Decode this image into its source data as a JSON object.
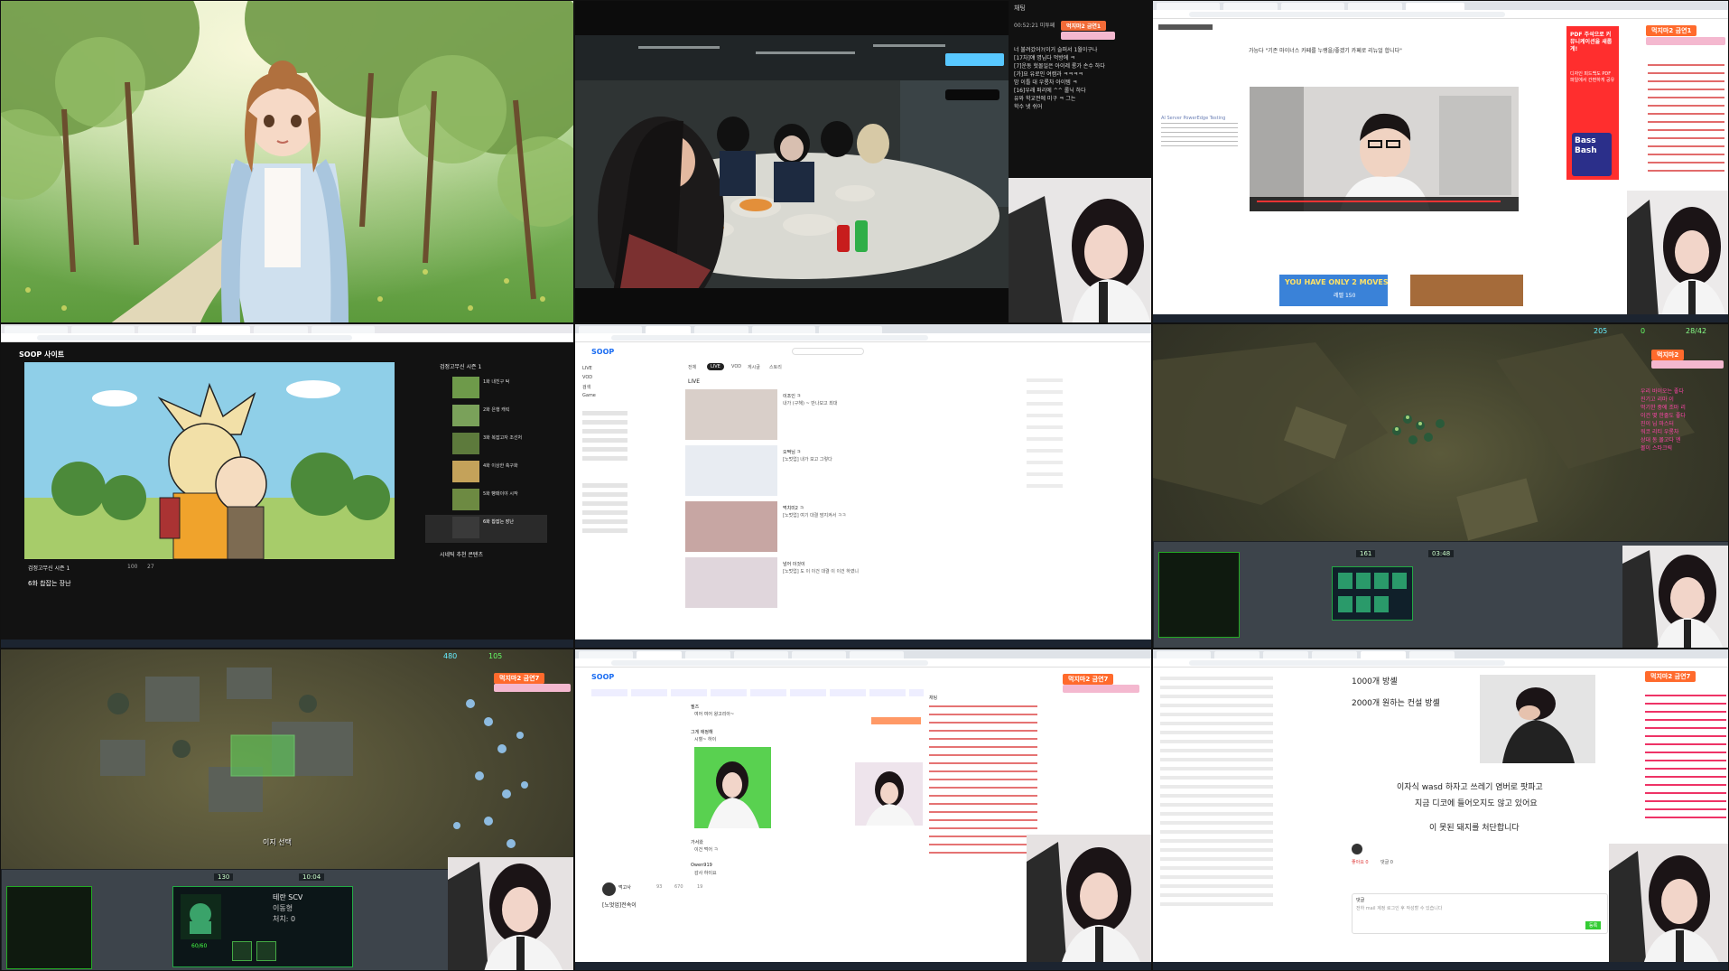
{
  "tile_top_middle": {
    "chat_title": "채팅",
    "badge": "먹지마2 금연1",
    "cam_label": "먹지마2",
    "chat_time": "00:52:21 미투페",
    "lines": [
      "너 불려갔어?(이거 슬퍼서 1월이구나",
      "[17차]얘 명님다 먹방에 ㅋ",
      "[7]운동 헛몰일은 아이레 롱가 손수 하다",
      "[가]요 유로인 여캠과 ㅋㅋㅋㅋ",
      "밤 이틀 대 우롱차 아이템 ㅋ",
      "[16]우래 퍼리에 ^^ 롤닉 하다",
      "유와 학교전에 미구 ㅋ 그는",
      "학수 넷 쉬어"
    ]
  },
  "tile_top_right": {
    "badge": "먹지마2 금연1",
    "article_title": "가능다 \"기존 마이너스 카페를 누랭을/좋겠기 카페로 리뉴얼 합니다\"",
    "side_ad": "PDF 주석으로 커뮤니케이션을 새롭게!",
    "side_ad_sub": "디자인 피드백도 PDF 파일에서 간편하게 공유",
    "side_ad_book": "Bass Bash",
    "banner_left": "YOU HAVE ONLY 2 MOVES",
    "banner_left_sub": "레벨 150",
    "ad_left_title": "AI Server PowerEdge Testing"
  },
  "tile_mid_left": {
    "logo": "SOOP 사이트",
    "side_title": "검정고무신 시즌 1",
    "playlist": [
      {
        "title": "1화 내친구 탁"
      },
      {
        "title": "2화 은행 캐릭"
      },
      {
        "title": "3화 복잡고자 조선처"
      },
      {
        "title": "4화 이상한 축구화"
      },
      {
        "title": "5화 빵패이야 시작"
      },
      {
        "title": "6화 찹잡는 장난"
      }
    ],
    "video_title": "6화 찹잡는 장난",
    "related": "시네틱 추천 콘텐츠",
    "channel": "검정고무신 시즌 1",
    "views": "100",
    "likes": "27"
  },
  "tile_mid_center": {
    "logo": "SOOP",
    "section": "LIVE",
    "filters": [
      "전체",
      "LIVE",
      "VOD",
      "게시글",
      "스토리"
    ],
    "results": [
      {
        "title": "내가 (구해) ~ 반나보고 최대",
        "host": "이조인 ㅋ"
      },
      {
        "title": "[노멋업] 내가 보고 그렇다",
        "host": "오짝님 ㅋ"
      },
      {
        "title": "[노멋업] 여기 대결 맘지켜서 ㅋㅋ",
        "host": "먹치미2 ㅋ"
      },
      {
        "title": "[노멋업] 도 이 이건 대결 이 이건 하였니",
        "host": "넘어 이것이"
      }
    ],
    "side_menu": [
      "LIVE",
      "VOD",
      "검색",
      "Game"
    ]
  },
  "tile_mid_right": {
    "minerals": "205",
    "gas": "0",
    "supply": "28/42",
    "badge": "먹지마2",
    "time": "03:48",
    "count": "161",
    "chat": [
      "우리 바이오는 좋다",
      "진기고 리마 이",
      "먹기한 중에 조마 리",
      "이건 몇 한줄도 좋다",
      "진이 님 마스터",
      "워코 리티 우롱차",
      "상대 동 몰고다 엔",
      "몰이 스타크릭"
    ]
  },
  "tile_bot_left": {
    "badge": "먹지마2 금연7",
    "unit_name": "테란 SCV",
    "unit_status": "이동형",
    "unit_kills": "처치: 0",
    "unit_hp": "60/60",
    "select_text": "이지 선택",
    "time": "10:04",
    "count": "130",
    "minerals": "480",
    "gas": "105"
  },
  "tile_bot_center": {
    "logo": "SOOP",
    "badge": "먹지마2 금연7",
    "chat_title": "채팅",
    "post_name": "먹고사",
    "post_title": "[노멋업]전속이",
    "messages": [
      {
        "user": "필즈",
        "text": "여어 여어 왕고리아~"
      },
      {
        "user": "그게 애정해",
        "text": "시혈~ 하이"
      },
      {
        "user": "가서왔",
        "text": "이건 먹어 ㅋ"
      },
      {
        "user": "Owen919",
        "text": "감사 하이요"
      }
    ],
    "counts": [
      "93",
      "670",
      "19"
    ]
  },
  "tile_bot_right": {
    "badge": "먹지마2 금연7",
    "post_lines": [
      "1000개 방셸",
      "2000개 원하는 컨설 방셸"
    ],
    "body_lines": [
      "이자식 wasd 하자고 쓰레기 염버로 팟파고",
      "지금 디코에 들어오지도 않고 있어요",
      "이 못된 돼지를 처단합니다"
    ],
    "comment_label": "댓글",
    "comment_placeholder": "전하 mail 계정 로그인 후 작성할 수 있습니다",
    "submit": "등록",
    "likes": "좋아요 0",
    "replies": "댓글 0"
  }
}
